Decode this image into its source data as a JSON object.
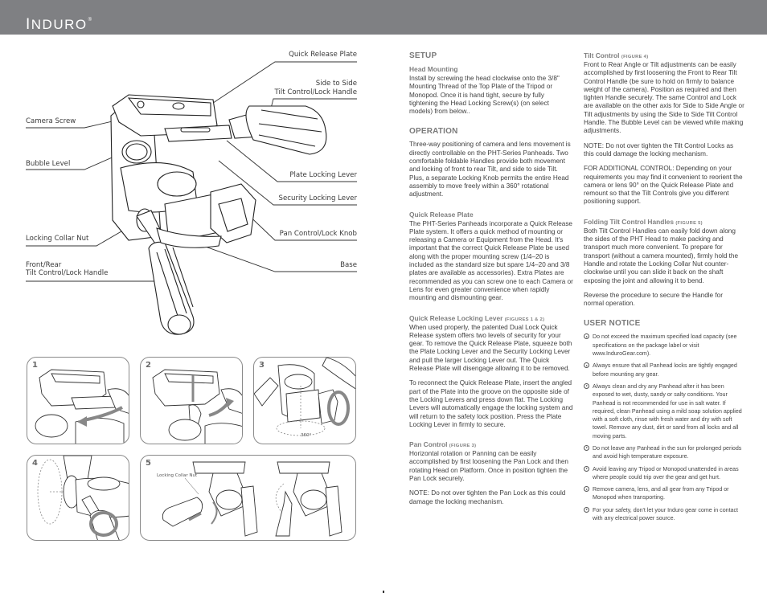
{
  "header": {
    "brand": "INDURO",
    "brand_first": "I",
    "brand_rest": "NDURO",
    "trademark": "®",
    "bar_color": "#7f8083"
  },
  "diagram": {
    "callouts": {
      "quick_release_plate": "Quick Release Plate",
      "side_to_side_line1": "Side to Side",
      "side_to_side_line2": "Tilt Control/Lock Handle",
      "camera_screw": "Camera Screw",
      "bubble_level": "Bubble Level",
      "plate_locking_lever": "Plate Locking Lever",
      "security_locking_lever": "Security Locking Lever",
      "locking_collar_nut": "Locking Collar Nut",
      "pan_control_lock_knob": "Pan Control/Lock Knob",
      "front_rear_line1": "Front/Rear",
      "front_rear_line2": "Tilt Control/Lock Handle",
      "base": "Base"
    }
  },
  "figures": [
    {
      "number": "1"
    },
    {
      "number": "2"
    },
    {
      "number": "3",
      "label": "360°"
    },
    {
      "number": "4"
    },
    {
      "number": "5",
      "label": "Locking Collar Nut"
    }
  ],
  "column1": {
    "setup_title": "SETUP",
    "head_mounting_title": "Head Mounting",
    "head_mounting_text": "Install by screwing the head clockwise onto the 3/8\" Mounting Thread of the Top Plate of the Tripod or Monopod. Once it is hand tight, secure by fully tightening the Head Locking Screw(s) (on select models) from below..",
    "operation_title": "OPERATION",
    "operation_text": "Three-way positioning of camera and lens movement is directly controllable on the PHT-Series Panheads. Two comfortable foldable Handles provide both movement and locking of front to rear Tilt, and side to side Tilt. Plus, a separate Locking Knob permits the entire Head assembly to move freely within a 360° rotational adjustment.",
    "qrp_title": "Quick Release Plate",
    "qrp_text": "The PHT-Series Panheads incorporate a Quick Release Plate system. It offers a quick method of mounting or releasing a Camera or Equipment from the Head. It's important that the correct Quick Release Plate be used along with the proper mounting screw (1/4–20 is included as the standard size but spare 1/4–20 and 3/8 plates are available as accessories). Extra Plates are recommended as you can screw one to each Camera or Lens for even greater convenience when rapidly mounting and dismounting gear.",
    "qrll_title": "Quick Release Locking Lever",
    "qrll_ref": "(FIGURES 1 & 2)",
    "qrll_text1": "When used properly, the patented Dual Lock Quick Release system offers two levels of security for your gear. To remove the Quick Release Plate, squeeze both the Plate Locking Lever and the Security Locking Lever and pull the larger Locking Lever out. The Quick Release Plate will disengage allowing it to be removed.",
    "qrll_text2": "To reconnect the Quick Release Plate, insert the angled part of the Plate into the groove on the opposite side of the Locking Levers and press down flat. The Locking Levers will automatically engage the locking system and will return to the safety lock position. Press the Plate Locking Lever in firmly to secure.",
    "pan_title": "Pan Control",
    "pan_ref": "(FIGURE 3)",
    "pan_text1": "Horizontal rotation or Panning can be easily accomplished by first loosening the Pan Lock and then rotating Head on Platform. Once in position tighten the Pan Lock securely.",
    "pan_text2": "NOTE: Do not over tighten the Pan Lock as this could damage the locking mechanism."
  },
  "column2": {
    "tilt_title": "Tilt Control",
    "tilt_ref": "(FIGURE 4)",
    "tilt_text1": "Front to Rear Angle or Tilt adjustments can be easily accomplished by first loosening the Front to Rear Tilt Control Handle (be sure to hold on firmly to balance weight of the camera). Position as required and then tighten Handle securely. The same Control and Lock are available on the other axis for Side to Side Angle or Tilt adjustments by using the Side to Side Tilt Control Handle. The Bubble Level can be viewed while making adjustments.",
    "tilt_text2": "NOTE: Do not over tighten the Tilt Control Locks as this could damage the locking mechanism.",
    "tilt_text3": "FOR ADDITIONAL CONTROL: Depending on your requirements you may find it convenient to reorient the camera or lens 90° on the Quick Release Plate and remount so that the Tilt Controls give you different positioning support.",
    "folding_title": "Folding Tilt Control Handles",
    "folding_ref": "(FIGURE 5)",
    "folding_text1": "Both Tilt Control Handles can easily fold down along the sides of the PHT Head to make packing and transport much more convenient. To prepare for transport (without a camera mounted), firmly hold the Handle and rotate the Locking Collar Nut counter-clockwise until you can slide it back on the shaft exposing the joint and allowing it to bend.",
    "folding_text2": "Reverse the procedure to secure the Handle for normal operation.",
    "notice_title": "USER NOTICE",
    "notices": [
      "Do not exceed the maximum specified load capacity (see specifications on the package label or visit www.InduroGear.com).",
      "Always ensure that all Panhead locks are tightly engaged before mounting any gear.",
      "Always clean and dry any Panhead after it has been exposed to wet, dusty, sandy or salty conditions. Your Panhead is not recommended for use in salt water. If required, clean Panhead using a mild soap solution applied with a soft cloth, rinse with fresh water and dry with soft towel. Remove any dust, dirt or sand from all locks and all moving parts.",
      "Do not leave any Panhead in the sun for prolonged periods and avoid high temperature exposure.",
      "Avoid leaving any Tripod or Monopod unattended in areas where people could trip over the gear and get hurt.",
      "Remove camera, lens, and all gear from any Tripod or Monopod when transporting.",
      "For your safety, don't let your Induro gear come in contact with any electrical power source."
    ]
  }
}
